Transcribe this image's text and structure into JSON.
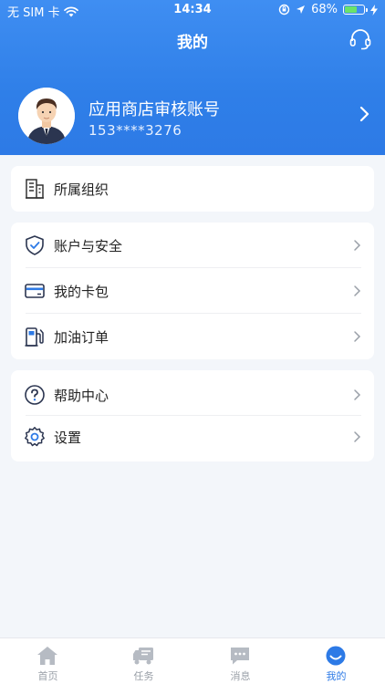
{
  "status_bar": {
    "carrier": "无 SIM 卡",
    "time": "14:34",
    "battery": "68%",
    "battery_level": 0.68
  },
  "header": {
    "title": "我的"
  },
  "profile": {
    "name": "应用商店审核账号",
    "phone": "153****3276"
  },
  "menu": {
    "group1": [
      {
        "label": "所属组织",
        "icon": "building-icon"
      }
    ],
    "group2": [
      {
        "label": "账户与安全",
        "icon": "shield-icon"
      },
      {
        "label": "我的卡包",
        "icon": "card-icon"
      },
      {
        "label": "加油订单",
        "icon": "fuel-pump-icon"
      }
    ],
    "group3": [
      {
        "label": "帮助中心",
        "icon": "help-icon"
      },
      {
        "label": "设置",
        "icon": "gear-icon"
      }
    ]
  },
  "tabs": [
    {
      "label": "首页",
      "icon": "home-icon"
    },
    {
      "label": "任务",
      "icon": "truck-icon"
    },
    {
      "label": "消息",
      "icon": "message-icon"
    },
    {
      "label": "我的",
      "icon": "profile-icon",
      "active": true
    }
  ],
  "colors": {
    "primary": "#2d7ae6",
    "background": "#f3f6fa",
    "inactive": "#9aa0a8"
  }
}
